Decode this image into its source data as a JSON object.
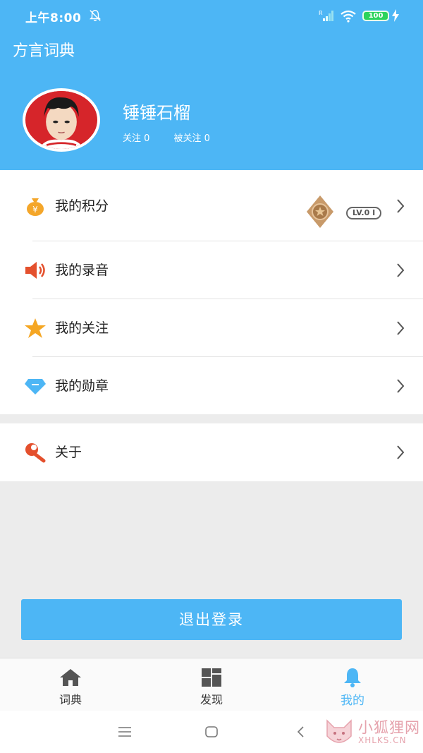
{
  "status": {
    "time": "上午8:00",
    "battery": "100",
    "icons": [
      "bell-off-icon",
      "signal-icon",
      "wifi-icon",
      "battery-icon",
      "charging-icon"
    ]
  },
  "header": {
    "title": "方言词典",
    "background": "#4db6f5"
  },
  "profile": {
    "username": "锤锤石榴",
    "following": "关注 0",
    "followers": "被关注 0"
  },
  "menu": {
    "items": [
      {
        "label": "我的积分",
        "icon": "money-bag-icon",
        "icon_color": "#f4a62a"
      },
      {
        "label": "我的录音",
        "icon": "speaker-icon",
        "icon_color": "#e4502d"
      },
      {
        "label": "我的关注",
        "icon": "star-icon",
        "icon_color": "#f5a623"
      },
      {
        "label": "我的勋章",
        "icon": "diamond-icon",
        "icon_color": "#4db6f5"
      }
    ],
    "level_badge": "LV.0 I",
    "about": {
      "label": "关于",
      "icon": "wrench-icon",
      "icon_color": "#e4502d"
    }
  },
  "logout": {
    "label": "退出登录"
  },
  "tabs": [
    {
      "label": "词典",
      "icon": "home-icon"
    },
    {
      "label": "发现",
      "icon": "grid-icon"
    },
    {
      "label": "我的",
      "icon": "bell-icon",
      "active": true
    }
  ],
  "accent_color": "#4db6f5",
  "watermark": {
    "text": "小狐狸网",
    "sub": "XHLKS.CN"
  }
}
